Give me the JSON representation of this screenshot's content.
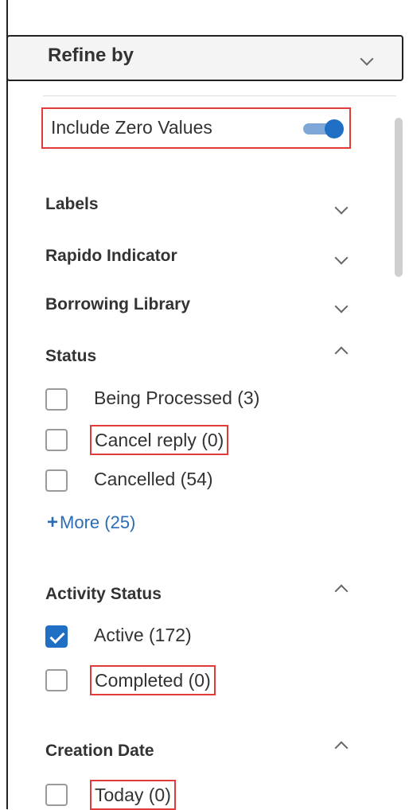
{
  "header": {
    "title": "Refine by"
  },
  "include_zero": {
    "label": "Include Zero Values",
    "enabled": true
  },
  "sections": {
    "labels": {
      "title": "Labels",
      "expanded": false
    },
    "rapido": {
      "title": "Rapido Indicator",
      "expanded": false
    },
    "borrowing": {
      "title": "Borrowing Library",
      "expanded": false
    },
    "status": {
      "title": "Status",
      "expanded": true,
      "options": [
        {
          "label": "Being Processed (3)",
          "checked": false
        },
        {
          "label": "Cancel reply (0)",
          "checked": false
        },
        {
          "label": "Cancelled (54)",
          "checked": false
        }
      ],
      "more_label": "More (25)"
    },
    "activity": {
      "title": "Activity Status",
      "expanded": true,
      "options": [
        {
          "label": "Active (172)",
          "checked": true
        },
        {
          "label": "Completed (0)",
          "checked": false
        }
      ]
    },
    "creation": {
      "title": "Creation Date",
      "expanded": true,
      "options": [
        {
          "label": "Today (0)",
          "checked": false
        }
      ]
    }
  },
  "colors": {
    "accent": "#1f6fc5",
    "highlight": "#e23b3b",
    "link": "#2a6cb5"
  }
}
